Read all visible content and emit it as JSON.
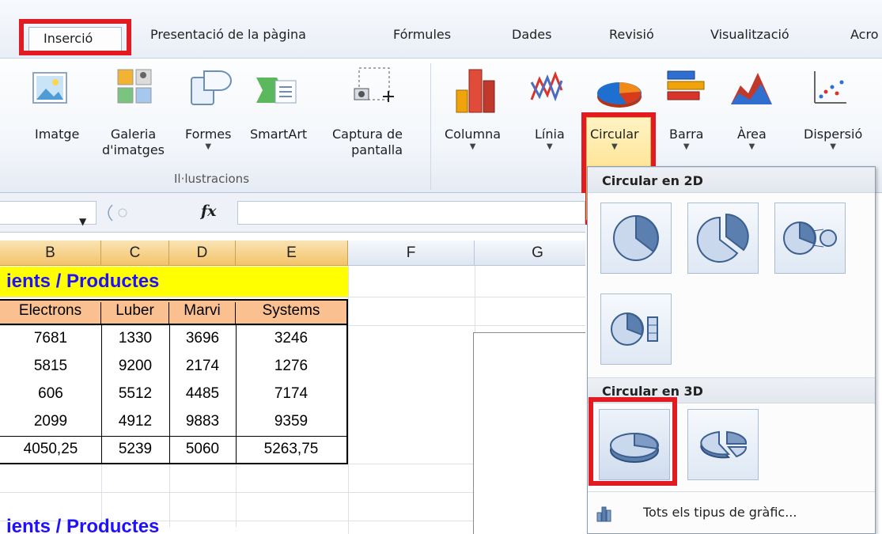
{
  "ribbon_tabs": {
    "active": "Inserció",
    "others": [
      "Presentació de la pàgina",
      "Fórmules",
      "Dades",
      "Revisió",
      "Visualització",
      "Acro"
    ]
  },
  "ribbon": {
    "illustrations": {
      "imatge": "Imatge",
      "galeria_1": "Galeria",
      "galeria_2": "d'imatges",
      "formes": "Formes",
      "smartart": "SmartArt",
      "captura_1": "Captura de",
      "captura_2": "pantalla",
      "group_label": "Il·lustracions"
    },
    "charts": {
      "columna": "Columna",
      "linia": "Línia",
      "circular": "Circular",
      "barra": "Barra",
      "area": "Àrea",
      "dispersio": "Dispersió"
    }
  },
  "formula_bar": {
    "fx": "fx"
  },
  "sheet": {
    "columns": [
      "B",
      "C",
      "D",
      "E",
      "F",
      "G"
    ],
    "title": "ients / Productes",
    "headers": [
      "Electrons",
      "Luber",
      "Marvi",
      "Systems"
    ],
    "rows": [
      [
        "7681",
        "1330",
        "3696",
        "3246"
      ],
      [
        "5815",
        "9200",
        "2174",
        "1276"
      ],
      [
        "606",
        "5512",
        "4485",
        "7174"
      ],
      [
        "2099",
        "4912",
        "9883",
        "9359"
      ],
      [
        "4050,25",
        "5239",
        "5060",
        "5263,75"
      ]
    ],
    "bottom_title": "ients / Productes"
  },
  "dropdown": {
    "section_2d": "Circular en 2D",
    "section_3d": "Circular en 3D",
    "footer_label": "Tots els tipus de gràfic..."
  },
  "colors": {
    "highlight_red": "#e21b23",
    "title_text": "#1f10ff",
    "title_fill": "#ffff00",
    "header_fill": "#fac090"
  }
}
